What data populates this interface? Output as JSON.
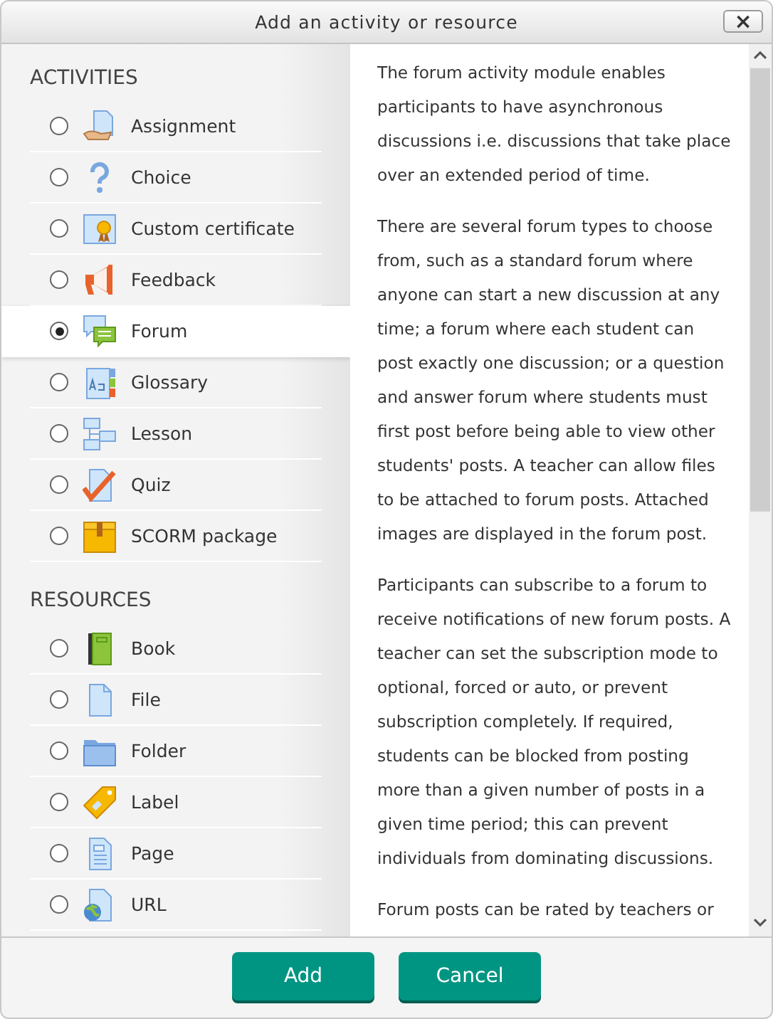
{
  "dialog": {
    "title": "Add an activity or resource",
    "close_label": "×"
  },
  "sections": [
    {
      "heading": "ACTIVITIES",
      "items": [
        {
          "label": "Assignment",
          "selected": false
        },
        {
          "label": "Choice",
          "selected": false
        },
        {
          "label": "Custom certificate",
          "selected": false
        },
        {
          "label": "Feedback",
          "selected": false
        },
        {
          "label": "Forum",
          "selected": true
        },
        {
          "label": "Glossary",
          "selected": false
        },
        {
          "label": "Lesson",
          "selected": false
        },
        {
          "label": "Quiz",
          "selected": false
        },
        {
          "label": "SCORM package",
          "selected": false
        }
      ]
    },
    {
      "heading": "RESOURCES",
      "items": [
        {
          "label": "Book",
          "selected": false
        },
        {
          "label": "File",
          "selected": false
        },
        {
          "label": "Folder",
          "selected": false
        },
        {
          "label": "Label",
          "selected": false
        },
        {
          "label": "Page",
          "selected": false
        },
        {
          "label": "URL",
          "selected": false
        }
      ]
    }
  ],
  "description": [
    "The forum activity module enables participants to have asynchronous discussions i.e. discussions that take place over an extended period of time.",
    "There are several forum types to choose from, such as a standard forum where anyone can start a new discussion at any time; a forum where each student can post exactly one discussion; or a question and answer forum where students must first post before being able to view other students' posts. A teacher can allow files to be attached to forum posts. Attached images are displayed in the forum post.",
    "Participants can subscribe to a forum to receive notifications of new forum posts. A teacher can set the subscription mode to optional, forced or auto, or prevent subscription completely. If required, students can be blocked from posting more than a given number of posts in a given time period; this can prevent individuals from dominating discussions.",
    "Forum posts can be rated by teachers or"
  ],
  "buttons": [
    "Add",
    "Cancel"
  ]
}
